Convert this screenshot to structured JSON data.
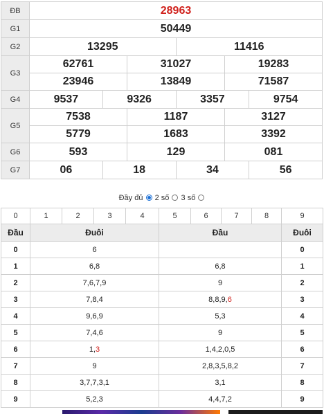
{
  "labels": {
    "db": "ĐB",
    "g1": "G1",
    "g2": "G2",
    "g3": "G3",
    "g4": "G4",
    "g5": "G5",
    "g6": "G6",
    "g7": "G7"
  },
  "prizes": {
    "db": "28963",
    "g1": "50449",
    "g2": [
      "13295",
      "11416"
    ],
    "g3": [
      "62761",
      "31027",
      "19283",
      "23946",
      "13849",
      "71587"
    ],
    "g4": [
      "9537",
      "9326",
      "3357",
      "9754"
    ],
    "g5": [
      "7538",
      "1187",
      "3127",
      "5779",
      "1683",
      "3392"
    ],
    "g6": [
      "593",
      "129",
      "081"
    ],
    "g7": [
      "06",
      "18",
      "34",
      "56"
    ]
  },
  "filter": {
    "full": "Đầy đủ",
    "two": "2 số",
    "three": "3 số",
    "selected": "full"
  },
  "digits": [
    "0",
    "1",
    "2",
    "3",
    "4",
    "5",
    "6",
    "7",
    "8",
    "9"
  ],
  "loto_headers": {
    "dau": "Đầu",
    "duoi": "Đuôi",
    "dau2": "Đầu",
    "duoi2": "Đuôi"
  },
  "loto_rows": [
    {
      "k": "0",
      "duoi": "6",
      "dau": ""
    },
    {
      "k": "1",
      "duoi": "6,8",
      "dau": "6,8"
    },
    {
      "k": "2",
      "duoi": "7,6,7,9",
      "dau": "9"
    },
    {
      "k": "3",
      "duoi": "7,8,4",
      "dau": "8,8,9,6"
    },
    {
      "k": "4",
      "duoi": "9,6,9",
      "dau": "5,3"
    },
    {
      "k": "5",
      "duoi": "7,4,6",
      "dau": "9"
    },
    {
      "k": "6",
      "duoi": "1,3",
      "dau": "1,4,2,0,5"
    },
    {
      "k": "7",
      "duoi": "9",
      "dau": "2,8,3,5,8,2"
    },
    {
      "k": "8",
      "duoi": "3,7,7,3,1",
      "dau": "3,1"
    },
    {
      "k": "9",
      "duoi": "5,2,3",
      "dau": "4,4,7,2"
    }
  ],
  "colors": {
    "special": "#d0211c",
    "header_bg": "#ececec",
    "radio": "#1a6fd6"
  }
}
